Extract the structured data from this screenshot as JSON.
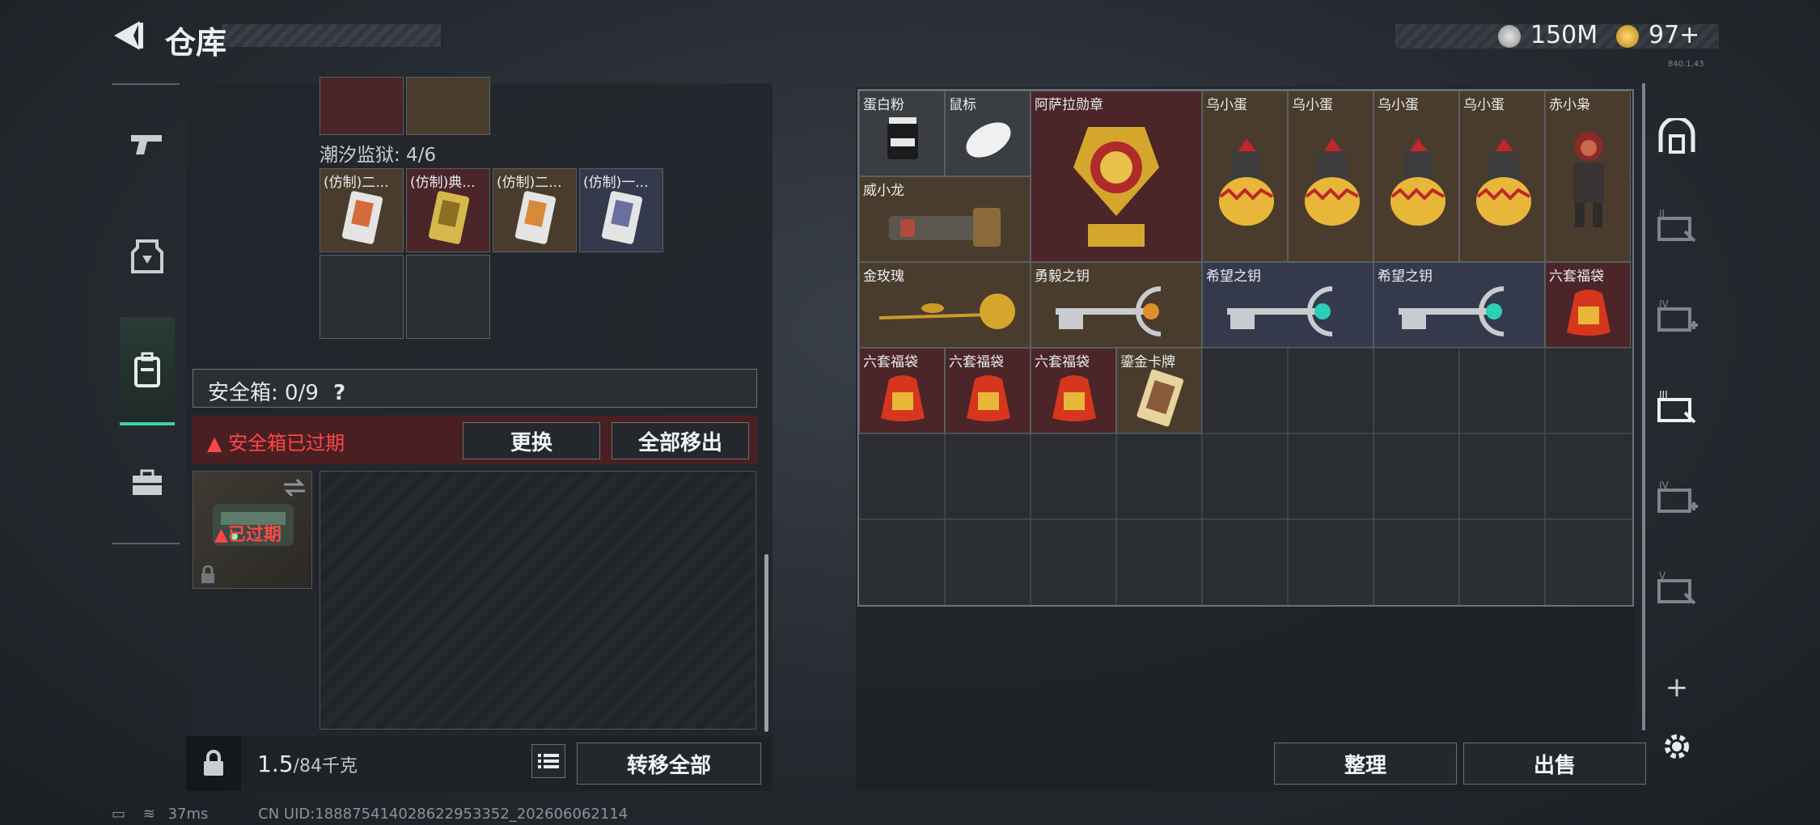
{
  "header": {
    "title": "仓库",
    "currency1": "150M",
    "currency2": "97+",
    "version": "840.1.43"
  },
  "left": {
    "section_label": "潮汐监狱: 4/6",
    "top_items": [
      "(仿制)二...",
      "(仿制)典...",
      "(仿制)二...",
      "(仿制)一..."
    ],
    "safebox_label": "安全箱: 0/9",
    "safebox_help": "?",
    "expired_warning": "安全箱已过期",
    "replace_button": "更换",
    "remove_all_button": "全部移出",
    "case_expired": "已过期",
    "weight_value": "1.5",
    "weight_capacity": "/84千克",
    "transfer_all_button": "转移全部"
  },
  "right": {
    "items": [
      {
        "name": "蛋白粉"
      },
      {
        "name": "鼠标"
      },
      {
        "name": "阿萨拉勋章"
      },
      {
        "name": "乌小蛋"
      },
      {
        "name": "乌小蛋"
      },
      {
        "name": "乌小蛋"
      },
      {
        "name": "乌小蛋"
      },
      {
        "name": "赤小枭"
      },
      {
        "name": "威小龙"
      },
      {
        "name": "金玫瑰"
      },
      {
        "name": "勇毅之钥"
      },
      {
        "name": "希望之钥"
      },
      {
        "name": "希望之钥"
      },
      {
        "name": "六套福袋"
      },
      {
        "name": "六套福袋"
      },
      {
        "name": "六套福袋"
      },
      {
        "name": "六套福袋"
      },
      {
        "name": "鎏金卡牌"
      }
    ],
    "sort_button": "整理",
    "sell_button": "出售",
    "side_tabs": [
      "II",
      "IV",
      "III",
      "IV",
      "V"
    ]
  },
  "status": {
    "ping": "37ms",
    "uid": "CN UID:188875414028622953352_202606062114"
  }
}
